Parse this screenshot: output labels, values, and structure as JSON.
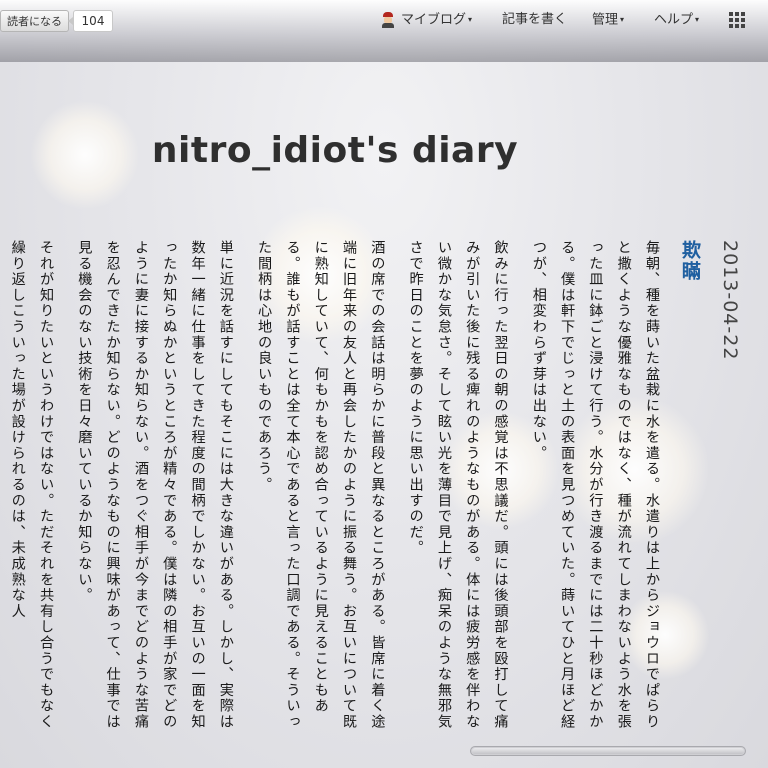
{
  "header": {
    "subscribe_label": "読者になる",
    "reader_count": "104",
    "nav": {
      "my_blog": "マイブログ",
      "write": "記事を書く",
      "manage": "管理",
      "help": "ヘルプ"
    }
  },
  "blog": {
    "title": "nitro_idiot's diary"
  },
  "entry": {
    "date": "2013-04-22",
    "title": "欺瞞",
    "paragraphs": [
      "毎朝、種を蒔いた盆栽に水を遣る。水遣りは上からジョウロでぱらりと撒くような優雅なものではなく、種が流れてしまわないよう水を張った皿に鉢ごと浸けて行う。水分が行き渡るまでには二十秒ほどかかる。僕は軒下でじっと土の表面を見つめていた。蒔いてひと月ほど経つが、相変わらず芽は出ない。",
      "飲みに行った翌日の朝の感覚は不思議だ。頭には後頭部を殴打して痛みが引いた後に残る痺れのようなものがある。体には疲労感を伴わない微かな気怠さ。そして眩い光を薄目で見上げ、痴呆のような無邪気さで昨日のことを夢のように思い出すのだ。",
      "酒の席での会話は明らかに普段と異なるところがある。皆席に着く途端に旧年来の友人と再会したかのように振る舞う。お互いについて既に熟知していて、何もかもを認め合っているように見えることもある。誰もが話すことは全て本心であると言った口調である。そういった間柄は心地の良いものであろう。",
      "単に近況を話すにしてもそこには大きな違いがある。しかし、実際は数年一緒に仕事をしてきた程度の間柄でしかない。お互いの一面を知ったか知らぬかというところが精々である。僕は隣の相手が家でどのように妻に接するか知らない。酒をつぐ相手が今までどのような苦痛を忍んできたか知らない。どのようなものに興味があって、仕事では見る機会のない技術を日々磨いているか知らない。",
      "それが知りたいというわけではない。ただそれを共有し合うでもなく繰り返しこういった場が設けられるのは、未成熟な人"
    ]
  }
}
